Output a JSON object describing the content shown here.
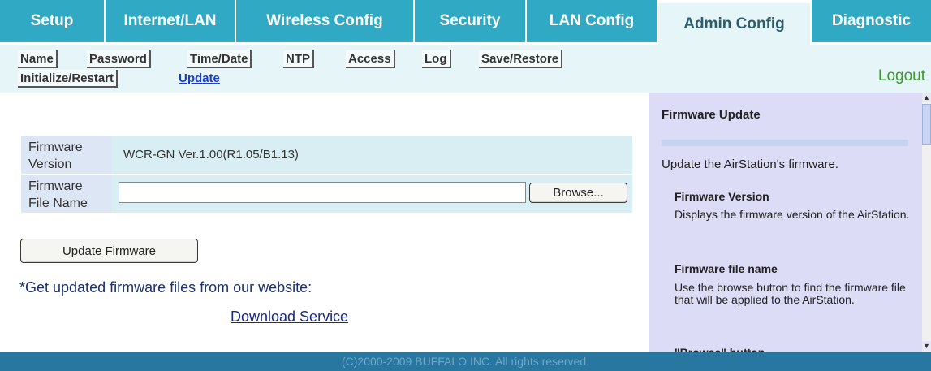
{
  "tabs": [
    {
      "label": "Setup"
    },
    {
      "label": "Internet/LAN"
    },
    {
      "label": "Wireless Config"
    },
    {
      "label": "Security"
    },
    {
      "label": "LAN Config"
    },
    {
      "label": "Admin Config",
      "active": true
    },
    {
      "label": "Diagnostic"
    }
  ],
  "subnav": {
    "items": [
      {
        "label": "Name"
      },
      {
        "label": "Password"
      },
      {
        "label": "Time/Date"
      },
      {
        "label": "NTP"
      },
      {
        "label": "Access"
      },
      {
        "label": "Log"
      },
      {
        "label": "Save/Restore"
      },
      {
        "label": "Initialize/Restart"
      },
      {
        "label": "Update",
        "current": true
      }
    ],
    "logout": "Logout"
  },
  "firmware": {
    "version_label_1": "Firmware",
    "version_label_2": "Version",
    "version_value": "WCR-GN Ver.1.00(R1.05/B1.13)",
    "file_label_1": "Firmware",
    "file_label_2": "File Name",
    "file_value": "",
    "browse_label": "Browse...",
    "update_label": "Update Firmware"
  },
  "note": "*Get updated firmware files from our website:",
  "download_label": "Download Service",
  "help": {
    "title": "Firmware Update",
    "intro": "Update the AirStation's firmware.",
    "sections": [
      {
        "head": "Firmware Version",
        "body": "Displays the firmware version of the AirStation."
      },
      {
        "head": "Firmware file name",
        "body": "Use the browse button to find the firmware file that will be applied to the AirStation."
      },
      {
        "head": "\"Browse\" button",
        "body": ""
      }
    ]
  },
  "footer": "(C)2000-2009 BUFFALO INC. All rights reserved.",
  "colors": {
    "tab_bg": "#2fa9c4",
    "active_tab_bg": "#e6f6f8",
    "help_bg": "#dcdcf6",
    "footer_bg": "#2777a0",
    "logout": "#3a9a2a"
  }
}
